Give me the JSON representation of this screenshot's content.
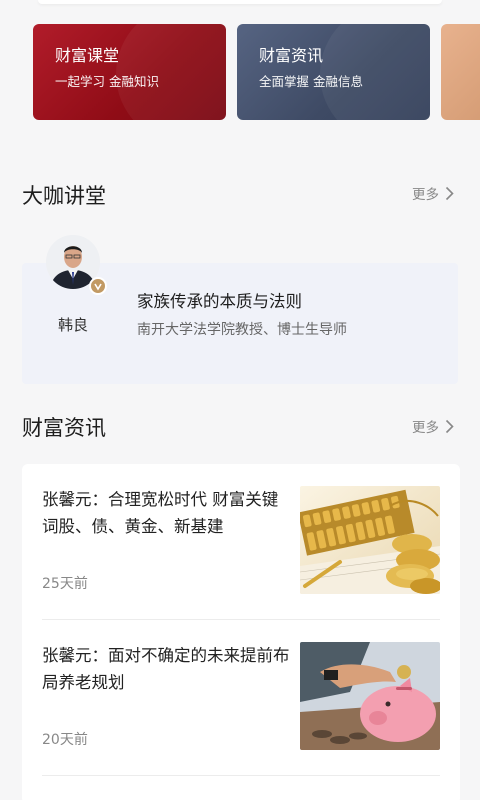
{
  "promo_cards": [
    {
      "title": "财富课堂",
      "subtitle": "一起学习 金融知识"
    },
    {
      "title": "财富资讯",
      "subtitle": "全面掌握 金融信息"
    }
  ],
  "lecture_section": {
    "title": "大咖讲堂",
    "more": "更多",
    "speaker_name": "韩良",
    "lecture_title": "家族传承的本质与法则",
    "speaker_desc": "南开大学法学院教授、博士生导师"
  },
  "news_section": {
    "title": "财富资讯",
    "more": "更多",
    "items": [
      {
        "title": "张馨元：合理宽松时代 财富关键词股、债、黄金、新基建",
        "time": "25天前"
      },
      {
        "title": "张馨元：面对不确定的未来提前布局养老规划",
        "time": "20天前"
      }
    ]
  },
  "colors": {
    "red_card": "#9a1220",
    "blue_card": "#46526d",
    "lecture_bg": "#f0f2f9",
    "badge": "#c29a64"
  }
}
